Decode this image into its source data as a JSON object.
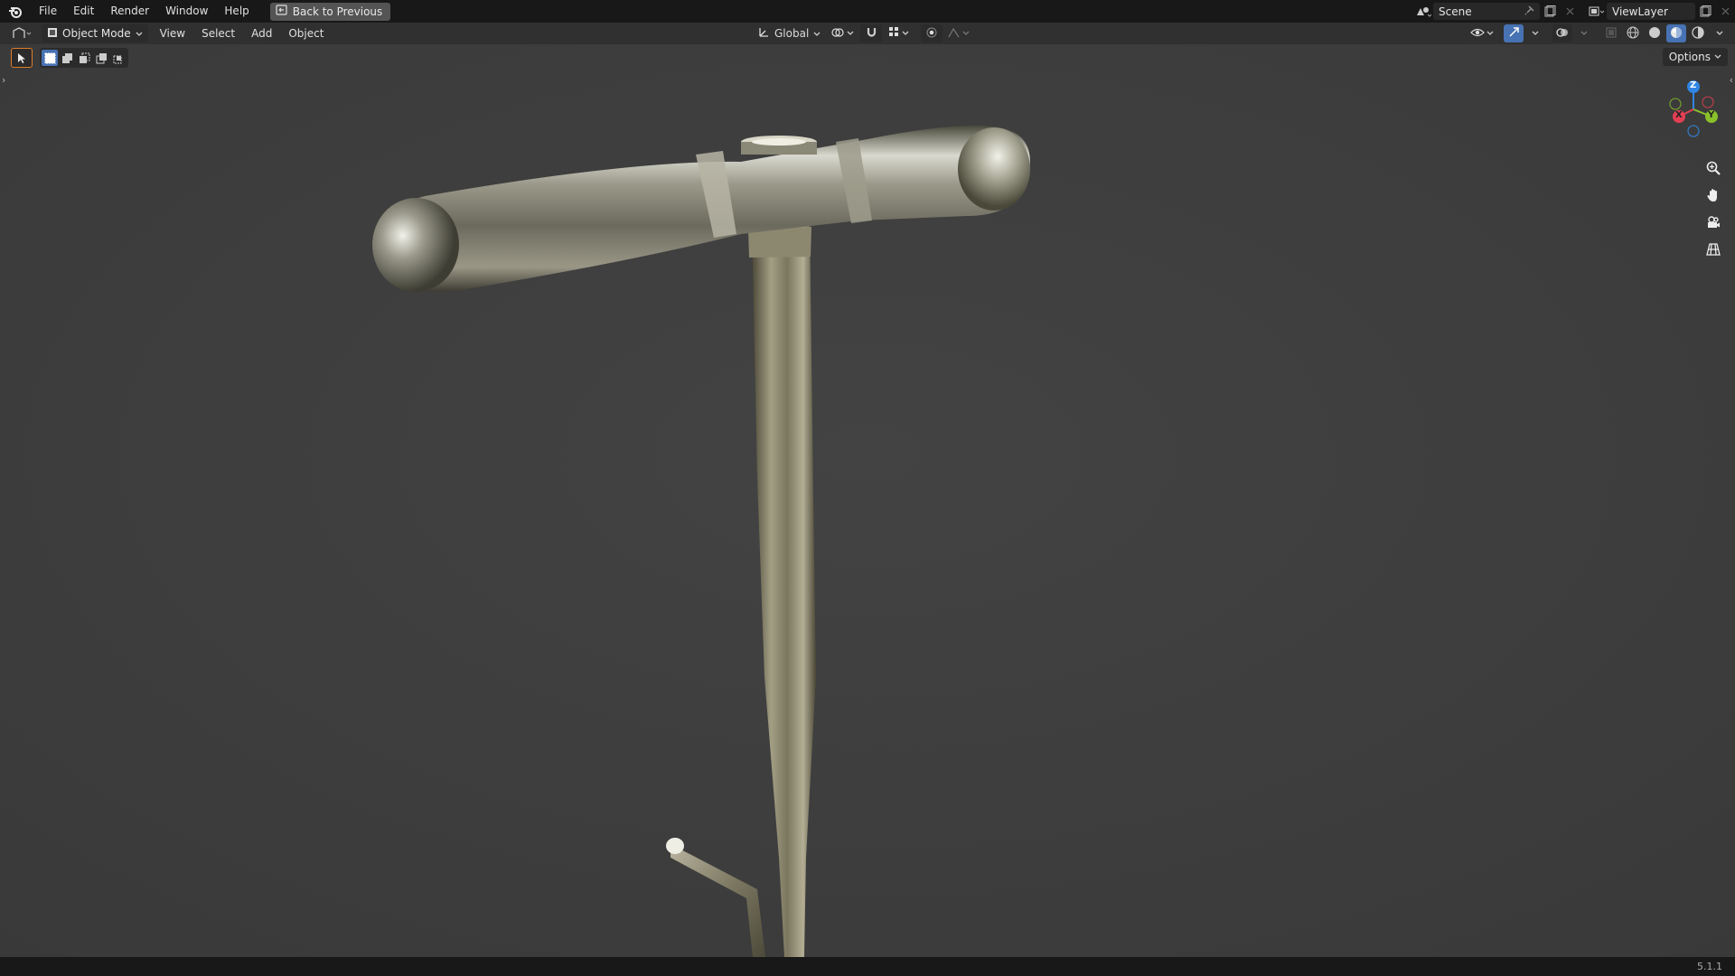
{
  "topbar": {
    "menus": [
      "File",
      "Edit",
      "Render",
      "Window",
      "Help"
    ],
    "back_button": "Back to Previous",
    "scene_name": "Scene",
    "view_layer_name": "ViewLayer"
  },
  "header": {
    "mode": "Object Mode",
    "menus": [
      "View",
      "Select",
      "Add",
      "Object"
    ],
    "transform_orientation": "Global"
  },
  "viewport": {
    "options_label": "Options",
    "gizmo": {
      "x_label": "X",
      "y_label": "Y",
      "z_label": "Z",
      "x_color": "#e23f53",
      "y_color": "#8ac12b",
      "z_color": "#2f86e3"
    },
    "nav_icons": [
      "zoom-icon",
      "pan-hand-icon",
      "camera-icon",
      "perspective-grid-icon"
    ]
  },
  "statusbar": {
    "version": "5.1.1"
  },
  "theme": {
    "accent": "#4772b3",
    "active_tool_outline": "#e07b28",
    "viewport_bg": "#3d3d3d"
  }
}
